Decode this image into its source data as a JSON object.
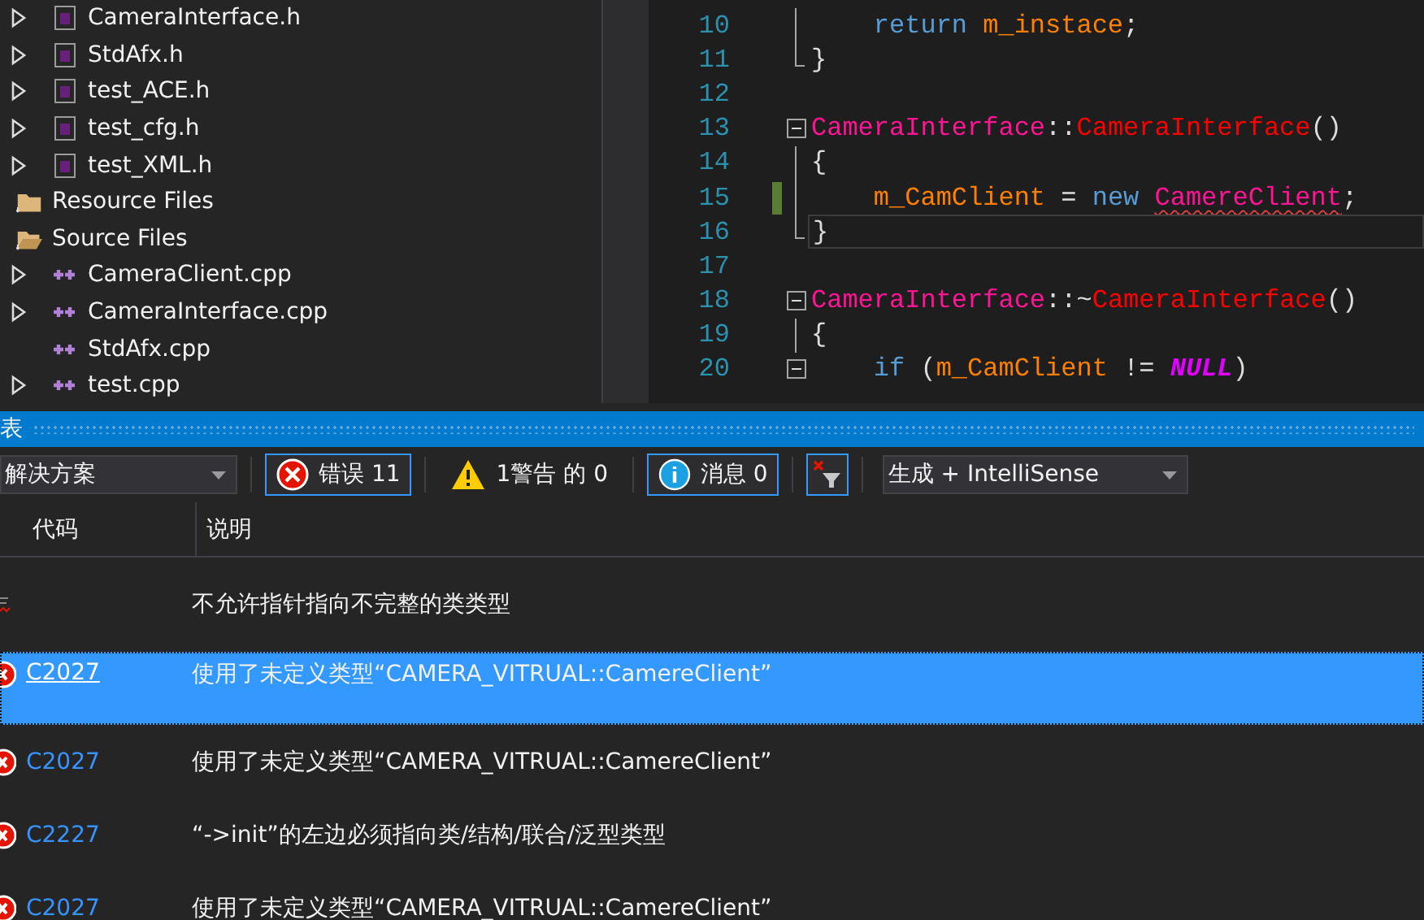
{
  "solution_explorer": {
    "items": [
      {
        "label": "CameraInterface.h",
        "kind": "header",
        "expandable": true
      },
      {
        "label": "StdAfx.h",
        "kind": "header",
        "expandable": true
      },
      {
        "label": "test_ACE.h",
        "kind": "header",
        "expandable": true
      },
      {
        "label": "test_cfg.h",
        "kind": "header",
        "expandable": true
      },
      {
        "label": "test_XML.h",
        "kind": "header",
        "expandable": true
      },
      {
        "label": "Resource Files",
        "kind": "folder",
        "expanded": false
      },
      {
        "label": "Source Files",
        "kind": "folder",
        "expanded": true,
        "children": [
          {
            "label": "CameraClient.cpp",
            "kind": "source",
            "expandable": true
          },
          {
            "label": "CameraInterface.cpp",
            "kind": "source",
            "expandable": true
          },
          {
            "label": "StdAfx.cpp",
            "kind": "source",
            "expandable": false
          },
          {
            "label": "test.cpp",
            "kind": "source",
            "expandable": true
          }
        ]
      }
    ]
  },
  "editor": {
    "lines": [
      {
        "number": "10",
        "kind": "block",
        "changed": false,
        "current": false,
        "tokens": [
          {
            "kind": "keyword",
            "text": "    return"
          },
          {
            "kind": "member",
            "text": " m_instace"
          },
          {
            "kind": "plain",
            "text": ";"
          }
        ]
      },
      {
        "number": "11",
        "kind": "block-end",
        "changed": false,
        "current": false,
        "tokens": [
          {
            "kind": "plain",
            "text": "}"
          }
        ]
      },
      {
        "number": "12",
        "kind": "plain",
        "changed": false,
        "current": false
      },
      {
        "number": "13",
        "kind": "fold-start",
        "changed": false,
        "current": false,
        "tokens": [
          {
            "kind": "type",
            "text": "CameraInterface"
          },
          {
            "kind": "plain",
            "text": "::"
          },
          {
            "kind": "function",
            "text": "CameraInterface"
          },
          {
            "kind": "plain",
            "text": "()"
          }
        ]
      },
      {
        "number": "14",
        "kind": "block",
        "changed": false,
        "current": false,
        "tokens": [
          {
            "kind": "plain",
            "text": "{"
          }
        ]
      },
      {
        "number": "15",
        "kind": "block",
        "changed": true,
        "current": false,
        "tokens": [
          {
            "kind": "member",
            "text": "    m_CamClient"
          },
          {
            "kind": "plain",
            "text": " ="
          },
          {
            "kind": "keyword",
            "text": " new "
          },
          {
            "kind": "error-type",
            "text": "CamereClient"
          },
          {
            "kind": "plain",
            "text": ";"
          }
        ]
      },
      {
        "number": "16",
        "kind": "block-end",
        "changed": false,
        "current": true,
        "tokens": [
          {
            "kind": "plain",
            "text": "}"
          }
        ]
      },
      {
        "number": "17",
        "kind": "plain",
        "changed": false,
        "current": false
      },
      {
        "number": "18",
        "kind": "fold-start",
        "changed": false,
        "current": false,
        "tokens": [
          {
            "kind": "type",
            "text": "CameraInterface"
          },
          {
            "kind": "plain",
            "text": "::~"
          },
          {
            "kind": "function",
            "text": "CameraInterface"
          },
          {
            "kind": "plain",
            "text": "()"
          }
        ]
      },
      {
        "number": "19",
        "kind": "block",
        "changed": false,
        "current": false,
        "tokens": [
          {
            "kind": "plain",
            "text": "{"
          }
        ]
      },
      {
        "number": "20",
        "kind": "fold-start",
        "changed": false,
        "current": false,
        "tokens": [
          {
            "kind": "keyword",
            "text": "    if"
          },
          {
            "kind": "plain",
            "text": " ("
          },
          {
            "kind": "member",
            "text": "m_CamClient"
          },
          {
            "kind": "plain",
            "text": " != "
          },
          {
            "kind": "macro",
            "text": "NULL"
          },
          {
            "kind": "plain",
            "text": ")"
          }
        ]
      }
    ]
  },
  "error_list": {
    "title": "表",
    "toolbar": {
      "scope": "解决方案",
      "filters": [
        {
          "kind": "error",
          "label": "错误 11",
          "selected": true
        },
        {
          "kind": "warning",
          "label": "1警告 的 0",
          "selected": false
        },
        {
          "kind": "info",
          "label": "消息 0",
          "selected": true
        }
      ],
      "filter_toggle": {
        "selected": true
      },
      "source": "生成 + IntelliSense"
    },
    "columns": [
      "代码",
      "说明"
    ],
    "rows": [
      {
        "kind": "intellisense",
        "description": "不允许指针指向不完整的类类型",
        "selected": false
      },
      {
        "kind": "error",
        "code": "C2027",
        "description": "使用了未定义类型“CAMERA_VITRUAL::CamereClient”",
        "selected": true
      },
      {
        "kind": "error",
        "code": "C2027",
        "description": "使用了未定义类型“CAMERA_VITRUAL::CamereClient”",
        "selected": false
      },
      {
        "kind": "error",
        "code": "C2227",
        "description": "“->init”的左边必须指向类/结构/联合/泛型类型",
        "selected": false
      },
      {
        "kind": "error",
        "code": "C2027",
        "description": "使用了未定义类型“CAMERA_VITRUAL::CamereClient”",
        "selected": false
      }
    ]
  }
}
